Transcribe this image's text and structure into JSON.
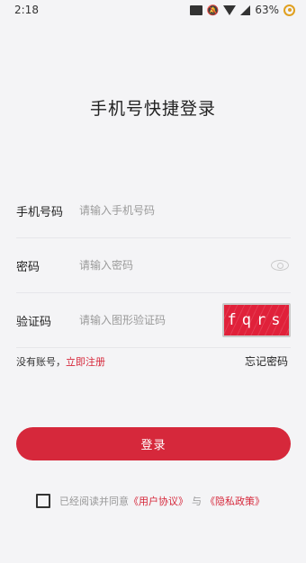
{
  "status_bar": {
    "time": "2:18",
    "battery": "63%"
  },
  "title": "手机号快捷登录",
  "phone": {
    "label": "手机号码",
    "placeholder": "请输入手机号码",
    "value": ""
  },
  "password": {
    "label": "密码",
    "placeholder": "请输入密码",
    "value": ""
  },
  "captcha": {
    "label": "验证码",
    "placeholder": "请输入图形验证码",
    "value": "",
    "image_text": "fqrs"
  },
  "links": {
    "no_account": "没有账号，",
    "register": "立即注册",
    "forgot": "忘记密码"
  },
  "login_button": "登录",
  "agreement": {
    "prefix": "已经阅读并同意",
    "user_agreement": "《用户协议》",
    "and": "与",
    "privacy_policy": "《隐私政策》",
    "checked": false
  },
  "colors": {
    "accent": "#d6283b",
    "background": "#f4f4f6",
    "captcha_bg": "#e0213a"
  }
}
